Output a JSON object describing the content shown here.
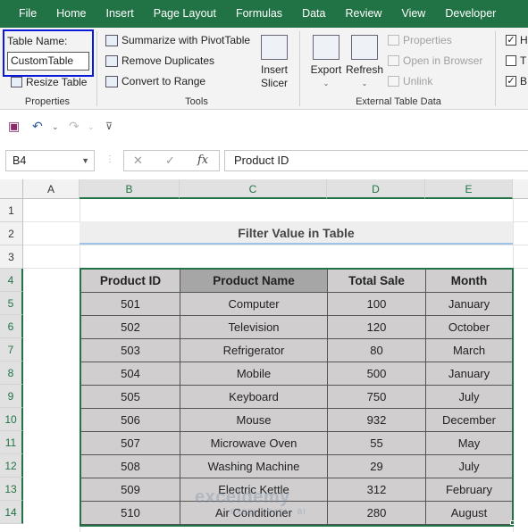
{
  "menu": [
    "File",
    "Home",
    "Insert",
    "Page Layout",
    "Formulas",
    "Data",
    "Review",
    "View",
    "Developer"
  ],
  "ribbon": {
    "table_name_label": "Table Name:",
    "table_name_value": "CustomTable",
    "resize_table": "Resize Table",
    "properties_group": "Properties",
    "summarize": "Summarize with PivotTable",
    "remove_duplicates": "Remove Duplicates",
    "convert_to_range": "Convert to Range",
    "insert_slicer_1": "Insert",
    "insert_slicer_2": "Slicer",
    "tools_group": "Tools",
    "export": "Export",
    "refresh": "Refresh",
    "properties": "Properties",
    "open_in_browser": "Open in Browser",
    "unlink": "Unlink",
    "external_group": "External Table Data",
    "style_options": [
      {
        "label": "H",
        "checked": true
      },
      {
        "label": "T",
        "checked": false
      },
      {
        "label": "B",
        "checked": true
      }
    ]
  },
  "formula_bar": {
    "cell_ref": "B4",
    "fx": "fx",
    "content": "Product ID"
  },
  "columns": [
    "A",
    "B",
    "C",
    "D",
    "E"
  ],
  "rows": [
    "1",
    "2",
    "3",
    "4",
    "5",
    "6",
    "7",
    "8",
    "9",
    "10",
    "11",
    "12",
    "13",
    "14"
  ],
  "title": "Filter Value in Table",
  "table": {
    "headers": [
      "Product ID",
      "Product Name",
      "Total Sale",
      "Month"
    ],
    "rows": [
      [
        "501",
        "Computer",
        "100",
        "January"
      ],
      [
        "502",
        "Television",
        "120",
        "October"
      ],
      [
        "503",
        "Refrigerator",
        "80",
        "March"
      ],
      [
        "504",
        "Mobile",
        "500",
        "January"
      ],
      [
        "505",
        "Keyboard",
        "750",
        "July"
      ],
      [
        "506",
        "Mouse",
        "932",
        "December"
      ],
      [
        "507",
        "Microwave Oven",
        "55",
        "May"
      ],
      [
        "508",
        "Washing Machine",
        "29",
        "July"
      ],
      [
        "509",
        "Electric Kettle",
        "312",
        "February"
      ],
      [
        "510",
        "Air Conditioner",
        "280",
        "August"
      ]
    ]
  },
  "watermark": {
    "main": "exceldemy",
    "sub": "EXCEL · DATA · BI"
  },
  "colors": {
    "excel_green": "#217346",
    "name_box_highlight": "#0a1ad8",
    "header_fill": "#d0cece",
    "name_header_fill": "#a6a6a6"
  }
}
